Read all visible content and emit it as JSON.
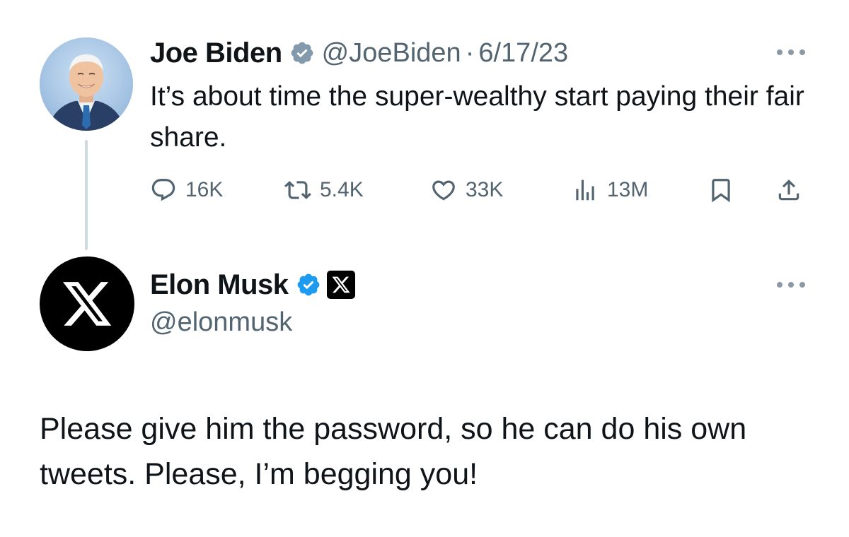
{
  "tweet1": {
    "author_name": "Joe Biden",
    "handle": "@JoeBiden",
    "separator": "·",
    "date": "6/17/23",
    "text": "It’s about time the super-wealthy start paying their fair share.",
    "stats": {
      "replies": "16K",
      "retweets": "5.4K",
      "likes": "33K",
      "views": "13M"
    },
    "badge": "verified-gray"
  },
  "tweet2": {
    "author_name": "Elon Musk",
    "handle": "@elonmusk",
    "text": "Please give him the password, so he can do his own tweets. Please, I’m begging you!",
    "badge": "verified-blue",
    "affiliate_badge": "x-logo"
  },
  "colors": {
    "text_primary": "#0f1419",
    "text_secondary": "#536471",
    "verified_blue": "#1d9bf0",
    "verified_gray": "#829aab",
    "thread_line": "#cfd9de"
  }
}
